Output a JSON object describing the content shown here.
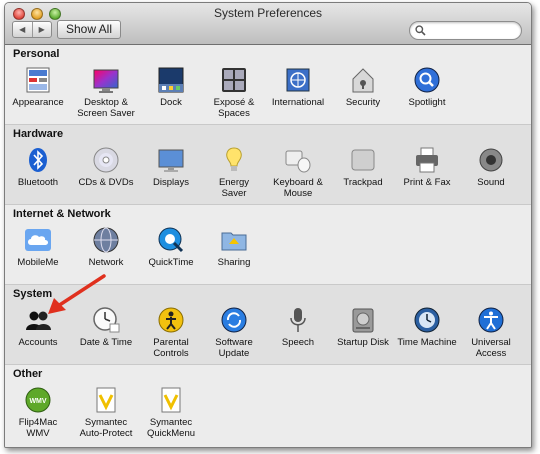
{
  "window": {
    "title": "System Preferences"
  },
  "toolbar": {
    "back_icon": "chevron-left-icon",
    "forward_icon": "chevron-right-icon",
    "show_all_label": "Show All",
    "search": {
      "value": "",
      "placeholder": "",
      "icon": "magnifier-icon"
    }
  },
  "sections": [
    {
      "title": "Personal",
      "items": [
        {
          "label": "Appearance",
          "icon": "appearance-icon"
        },
        {
          "label": "Desktop &\nScreen Saver",
          "icon": "desktop-icon"
        },
        {
          "label": "Dock",
          "icon": "dock-icon"
        },
        {
          "label": "Exposé &\nSpaces",
          "icon": "expose-icon"
        },
        {
          "label": "International",
          "icon": "international-icon"
        },
        {
          "label": "Security",
          "icon": "security-icon"
        },
        {
          "label": "Spotlight",
          "icon": "spotlight-icon"
        }
      ]
    },
    {
      "title": "Hardware",
      "items": [
        {
          "label": "Bluetooth",
          "icon": "bluetooth-icon"
        },
        {
          "label": "CDs & DVDs",
          "icon": "cd-icon"
        },
        {
          "label": "Displays",
          "icon": "display-icon"
        },
        {
          "label": "Energy\nSaver",
          "icon": "lightbulb-icon"
        },
        {
          "label": "Keyboard &\nMouse",
          "icon": "keyboard-mouse-icon"
        },
        {
          "label": "Trackpad",
          "icon": "trackpad-icon"
        },
        {
          "label": "Print & Fax",
          "icon": "printer-icon"
        },
        {
          "label": "Sound",
          "icon": "speaker-icon"
        }
      ]
    },
    {
      "title": "Internet & Network",
      "items": [
        {
          "label": "MobileMe",
          "icon": "cloud-icon"
        },
        {
          "label": "Network",
          "icon": "globe-icon"
        },
        {
          "label": "QuickTime",
          "icon": "quicktime-icon"
        },
        {
          "label": "Sharing",
          "icon": "sharing-folder-icon"
        }
      ]
    },
    {
      "title": "System",
      "items": [
        {
          "label": "Accounts",
          "icon": "accounts-icon"
        },
        {
          "label": "Date & Time",
          "icon": "clock-icon"
        },
        {
          "label": "Parental\nControls",
          "icon": "parental-controls-icon"
        },
        {
          "label": "Software\nUpdate",
          "icon": "software-update-icon"
        },
        {
          "label": "Speech",
          "icon": "microphone-icon"
        },
        {
          "label": "Startup Disk",
          "icon": "disk-icon"
        },
        {
          "label": "Time Machine",
          "icon": "time-machine-icon"
        },
        {
          "label": "Universal\nAccess",
          "icon": "universal-access-icon"
        }
      ]
    },
    {
      "title": "Other",
      "items": [
        {
          "label": "Flip4Mac\nWMV",
          "icon": "wmv-icon"
        },
        {
          "label": "Symantec\nAuto-Protect",
          "icon": "symantec-icon"
        },
        {
          "label": "Symantec\nQuickMenu",
          "icon": "symantec-quickmenu-icon"
        }
      ]
    }
  ],
  "annotation": {
    "icon": "red-arrow-icon",
    "color": "#e0301e"
  }
}
